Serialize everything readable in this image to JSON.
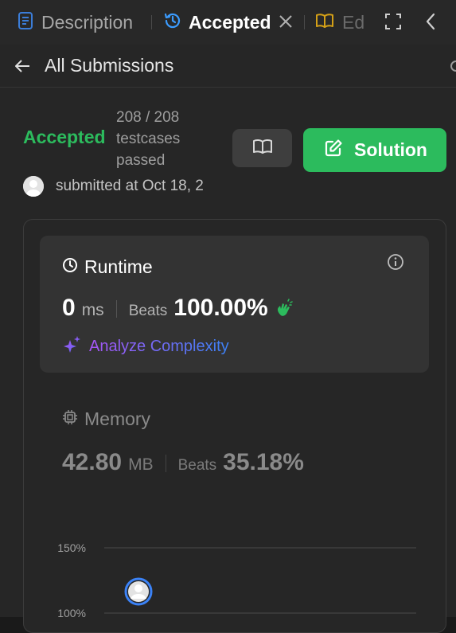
{
  "tabs": [
    {
      "label": "Description",
      "icon": "document-icon"
    },
    {
      "label": "Accepted",
      "icon": "history-icon",
      "active": true
    },
    {
      "label": "Ed",
      "icon": "book-icon"
    }
  ],
  "header": {
    "title": "All Submissions"
  },
  "submission": {
    "status": "Accepted",
    "cases": "208 / 208 testcases passed",
    "solution_label": "Solution",
    "submitted": "submitted at Oct 18, 2"
  },
  "runtime": {
    "title": "Runtime",
    "value": "0",
    "unit": "ms",
    "beats_label": "Beats",
    "beats": "100.00%",
    "analyze": "Analyze Complexity"
  },
  "memory": {
    "title": "Memory",
    "value": "42.80",
    "unit": "MB",
    "beats_label": "Beats",
    "beats": "35.18%"
  },
  "chart_data": {
    "type": "scatter",
    "ticks": [
      "150%",
      "100%"
    ],
    "y_ticks_values": [
      150,
      100
    ]
  },
  "colors": {
    "accent_green": "#2cbb5d",
    "active_tab_icon": "#3b9cff",
    "editorial_icon": "#d4a017"
  }
}
